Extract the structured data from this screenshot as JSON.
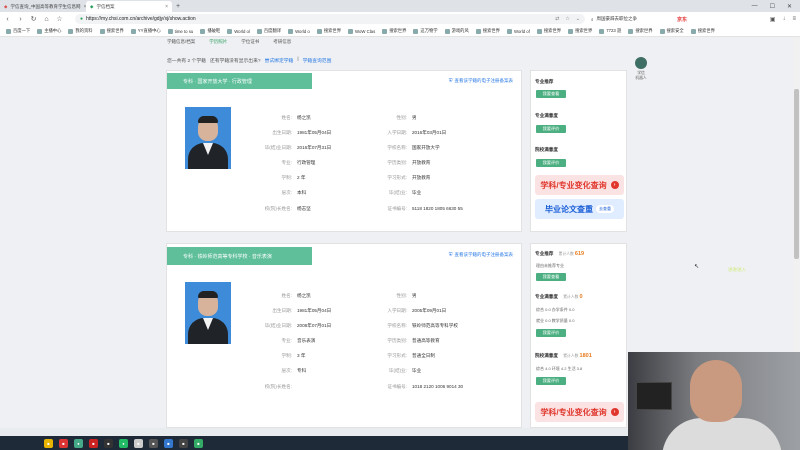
{
  "browser": {
    "tabs": [
      {
        "title": "学信查询_中国高等教育学生信息网",
        "active": false
      },
      {
        "title": "学信档案",
        "active": true
      }
    ],
    "url": "https://my.chsi.com.cn/archive/gdjy/xj/show.action",
    "search_placeholder": "周国豪辞去职位之争",
    "brand": "京东",
    "bookmarks": [
      "百度一下",
      "主播中心",
      "我的资料",
      "搜索世界",
      "YY直播中心",
      "time to su",
      "播破鞋",
      "World ol",
      "百度翻译",
      "World o",
      "搜索世界",
      "WoW Clas",
      "搜索世界",
      "这万物学",
      "游戏的风",
      "搜索世界",
      "World of",
      "搜索世界",
      "搜索世界",
      "7723 遊",
      "搜索世界",
      "搜索安全",
      "搜索世界"
    ]
  },
  "site_nav": {
    "items": [
      {
        "label": "学籍信息",
        "active": false
      },
      {
        "label": "学历信息",
        "active": false
      },
      {
        "label": "学位信息",
        "active": false
      },
      {
        "label": "考研信息",
        "active": false
      }
    ],
    "sub": [
      {
        "label": "学籍信息/档案",
        "active": false
      },
      {
        "label": "学历照片",
        "active": true
      },
      {
        "label": "学位证书",
        "active": false
      }
    ]
  },
  "summary": {
    "text": "您一共有 2 个学籍",
    "question": "还有学籍没有显示出来?",
    "bind_link": "尝试绑定学籍",
    "faq_link": "学籍查询范围"
  },
  "cards": [
    {
      "header": "专科 · 国家开放大学 · 行政管理",
      "verify_link": "查看该学籍的电子注册备案表",
      "fields_left": [
        {
          "label": "姓名:",
          "value": "杨之凯"
        },
        {
          "label": "出生日期:",
          "value": "1981年05月04日"
        },
        {
          "label": "毕(结)业日期:",
          "value": "2016年07月31日"
        },
        {
          "label": "专业:",
          "value": "行政管理"
        },
        {
          "label": "学制:",
          "value": "2 年"
        },
        {
          "label": "层次:",
          "value": "本科"
        },
        {
          "label": "校(院)长姓名:",
          "value": "杨志坚"
        }
      ],
      "fields_right": [
        {
          "label": "性别:",
          "value": "男"
        },
        {
          "label": "入学日期:",
          "value": "2016年03月01日"
        },
        {
          "label": "学校名称:",
          "value": "国家开放大学"
        },
        {
          "label": "学历类别:",
          "value": "开放教育"
        },
        {
          "label": "学习形式:",
          "value": "开放教育"
        },
        {
          "label": "毕(结)业:",
          "value": "毕业"
        },
        {
          "label": "证书编号:",
          "value": "5118 1820 1805 6630 55"
        }
      ]
    },
    {
      "header": "专科 · 铁岭师范高等专科学校 · 音乐表演",
      "verify_link": "查看该学籍的电子注册备案表",
      "fields_left": [
        {
          "label": "姓名:",
          "value": "杨之凯"
        },
        {
          "label": "出生日期:",
          "value": "1981年05月04日"
        },
        {
          "label": "毕(结)业日期:",
          "value": "2008年07月01日"
        },
        {
          "label": "专业:",
          "value": "音乐表演"
        },
        {
          "label": "学制:",
          "value": "3 年"
        },
        {
          "label": "层次:",
          "value": "专科"
        },
        {
          "label": "校(院)长姓名:",
          "value": ""
        }
      ],
      "fields_right": [
        {
          "label": "性别:",
          "value": "男"
        },
        {
          "label": "入学日期:",
          "value": "2005年09月01日"
        },
        {
          "label": "学校名称:",
          "value": "铁岭师范高等专科学校"
        },
        {
          "label": "学历类别:",
          "value": "普通高等教育"
        },
        {
          "label": "学习形式:",
          "value": "普通全日制"
        },
        {
          "label": "毕(结)业:",
          "value": "毕业"
        },
        {
          "label": "证书编号:",
          "value": "1018 2120 1006 9014 30"
        }
      ]
    }
  ],
  "sidebar1": {
    "recommend": "专业推荐",
    "recommend_btn": "我要查看",
    "major_sat": "专业满意度",
    "major_sat_btn": "我要评价",
    "school_sat": "院校满意度",
    "school_sat_btn": "我要评价",
    "banner1": "学科/专业变化查询",
    "banner2": "毕业论文查重",
    "banner2_btn": "去查重"
  },
  "sidebar2": {
    "recommend": "专业推荐",
    "recommend_count_label": "累计人数",
    "recommend_count": "619",
    "recommend_sub": "理由未推荐专业",
    "recommend_btn": "我要查看",
    "major_sat": "专业满意度",
    "major_count_label": "累计人数",
    "major_count": "0",
    "major_rows": [
      "综合  0.0   办学条件  0.0",
      "就业  0.0   教学质量  0.0"
    ],
    "major_btn": "我要评价",
    "school_sat": "院校满意度",
    "school_count_label": "累计人数",
    "school_count": "1801",
    "school_rows": [
      "综合  4.0   环境  4.2   生活  3.8"
    ],
    "school_btn": "我要评价",
    "banner": "学科/专业变化查询"
  },
  "robot": {
    "label": "学信\n机器人"
  },
  "overlay": "进进进入"
}
